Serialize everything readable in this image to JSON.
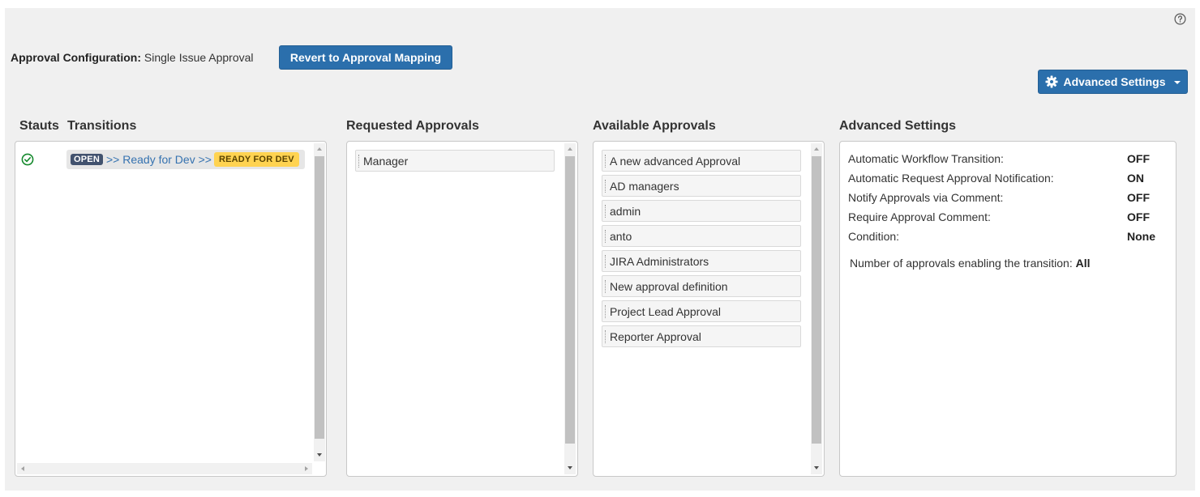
{
  "config": {
    "label": "Approval Configuration:",
    "value": "Single Issue Approval",
    "revert_button": "Revert to Approval Mapping",
    "advanced_settings_button": "Advanced Settings"
  },
  "columns": {
    "status": "Stauts",
    "transitions": "Transitions",
    "requested": "Requested Approvals",
    "available": "Available Approvals",
    "advanced": "Advanced Settings"
  },
  "transition": {
    "from": "OPEN",
    "name": ">> Ready for Dev >>",
    "to": "READY FOR DEV"
  },
  "requested_approvals": [
    "Manager"
  ],
  "available_approvals": [
    "A new advanced Approval",
    "AD managers",
    "admin",
    "anto",
    "JIRA Administrators",
    "New approval definition",
    "Project Lead Approval",
    "Reporter Approval"
  ],
  "advanced_settings": [
    {
      "label": "Automatic Workflow Transition:",
      "value": "OFF"
    },
    {
      "label": "Automatic Request Approval Notification:",
      "value": "ON"
    },
    {
      "label": "Notify Approvals via Comment:",
      "value": "OFF"
    },
    {
      "label": "Require Approval Comment:",
      "value": "OFF"
    },
    {
      "label": "Condition:",
      "value": "None"
    }
  ],
  "num_approvals": {
    "label": "Number of approvals enabling the transition:",
    "value": "All"
  },
  "icons": {
    "help": "question-circle-icon",
    "gear": "gear-icon",
    "status": "check-circle-icon"
  },
  "colors": {
    "primary": "#2b6fac",
    "open_lozenge": "#42526e",
    "ready_lozenge": "#ffd351",
    "link": "#3572b0",
    "check": "#14892c"
  }
}
